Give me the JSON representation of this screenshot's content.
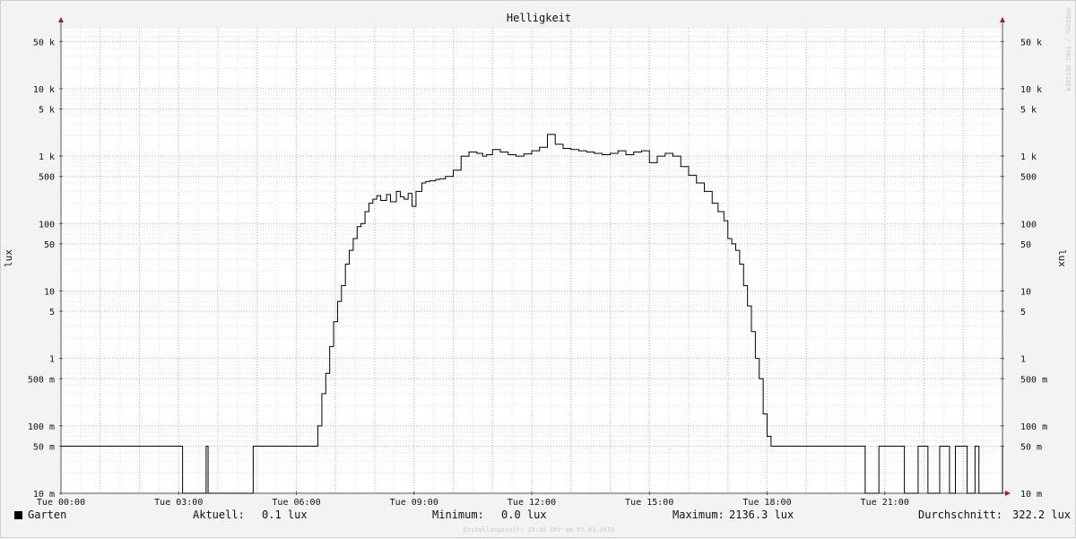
{
  "chart_data": {
    "type": "line",
    "title": "Helligkeit",
    "ylabel": "lux",
    "ylabel_right": "lux",
    "yscale": "log",
    "ylim": [
      0.01,
      80000
    ],
    "y_ticks": [
      {
        "value": 0.01,
        "label": "10 m"
      },
      {
        "value": 0.05,
        "label": "50 m"
      },
      {
        "value": 0.1,
        "label": "100 m"
      },
      {
        "value": 0.5,
        "label": "500 m"
      },
      {
        "value": 1,
        "label": "1"
      },
      {
        "value": 5,
        "label": "5"
      },
      {
        "value": 10,
        "label": "10"
      },
      {
        "value": 50,
        "label": "50"
      },
      {
        "value": 100,
        "label": "100"
      },
      {
        "value": 500,
        "label": "500"
      },
      {
        "value": 1000,
        "label": "1 k"
      },
      {
        "value": 5000,
        "label": "5 k"
      },
      {
        "value": 10000,
        "label": "10 k"
      },
      {
        "value": 50000,
        "label": "50 k"
      }
    ],
    "xlim": [
      0,
      24
    ],
    "x_ticks": [
      {
        "value": 0,
        "label": "Tue 00:00"
      },
      {
        "value": 3,
        "label": "Tue 03:00"
      },
      {
        "value": 6,
        "label": "Tue 06:00"
      },
      {
        "value": 9,
        "label": "Tue 09:00"
      },
      {
        "value": 12,
        "label": "Tue 12:00"
      },
      {
        "value": 15,
        "label": "Tue 15:00"
      },
      {
        "value": 18,
        "label": "Tue 18:00"
      },
      {
        "value": 21,
        "label": "Tue 21:00"
      }
    ],
    "grid": true,
    "watermark": "RRDTOOL / TOBI OETIKER",
    "series": [
      {
        "name": "Garten",
        "color": "#000000",
        "x": [
          0,
          3.1,
          3.7,
          3.75,
          4.9,
          6.45,
          6.55,
          6.65,
          6.75,
          6.85,
          6.95,
          7.05,
          7.15,
          7.25,
          7.35,
          7.45,
          7.55,
          7.65,
          7.75,
          7.85,
          7.95,
          8.05,
          8.15,
          8.3,
          8.4,
          8.55,
          8.65,
          8.75,
          8.85,
          8.95,
          9.05,
          9.2,
          9.3,
          9.4,
          9.55,
          9.65,
          9.8,
          10.0,
          10.2,
          10.4,
          10.6,
          10.75,
          10.85,
          11.0,
          11.2,
          11.4,
          11.6,
          11.8,
          12.0,
          12.2,
          12.4,
          12.6,
          12.8,
          13.0,
          13.2,
          13.4,
          13.6,
          13.8,
          14.0,
          14.2,
          14.4,
          14.6,
          14.8,
          15.0,
          15.2,
          15.4,
          15.6,
          15.8,
          16.0,
          16.2,
          16.4,
          16.6,
          16.75,
          16.9,
          17.0,
          17.1,
          17.2,
          17.3,
          17.4,
          17.5,
          17.6,
          17.7,
          17.8,
          17.9,
          18.0,
          18.1,
          18.2,
          18.3,
          18.4,
          18.5,
          18.6,
          18.7,
          20.5,
          20.85,
          21.5,
          21.85,
          22.1,
          22.4,
          22.65,
          22.8,
          23.1,
          23.3,
          23.4,
          24.0
        ],
        "values": [
          0.05,
          0.01,
          0.05,
          0.01,
          0.05,
          0.05,
          0.1,
          0.3,
          0.6,
          1.5,
          3.5,
          7,
          12,
          25,
          40,
          60,
          90,
          100,
          150,
          200,
          230,
          260,
          220,
          270,
          210,
          300,
          250,
          230,
          280,
          180,
          300,
          400,
          420,
          430,
          450,
          460,
          500,
          620,
          1000,
          1150,
          1100,
          1000,
          1050,
          1250,
          1150,
          1050,
          1000,
          1080,
          1200,
          1350,
          2100,
          1500,
          1300,
          1250,
          1200,
          1150,
          1100,
          1050,
          1100,
          1200,
          1050,
          1150,
          1200,
          800,
          1000,
          1100,
          1000,
          700,
          520,
          400,
          300,
          200,
          150,
          110,
          60,
          50,
          40,
          25,
          12,
          6,
          2.5,
          1,
          0.5,
          0.15,
          0.07,
          0.05,
          0.05,
          0.05,
          0.05,
          0.05,
          0.05,
          0.05,
          0.01,
          0.05,
          0.01,
          0.05,
          0.01,
          0.05,
          0.01,
          0.05,
          0.01,
          0.05,
          0.01,
          0.05
        ]
      }
    ],
    "legend": {
      "series_name": "Garten",
      "current_label": "Aktuell:",
      "current_value": "0.1 lux",
      "min_label": "Minimum:",
      "min_value": "0.0 lux",
      "max_label": "Maximum:",
      "max_value": "2136.3 lux",
      "avg_label": "Durchschnitt:",
      "avg_value": "322.2 lux"
    },
    "footer": "Erstellungszeit: 23:55 Uhr am 07.03.2023"
  }
}
